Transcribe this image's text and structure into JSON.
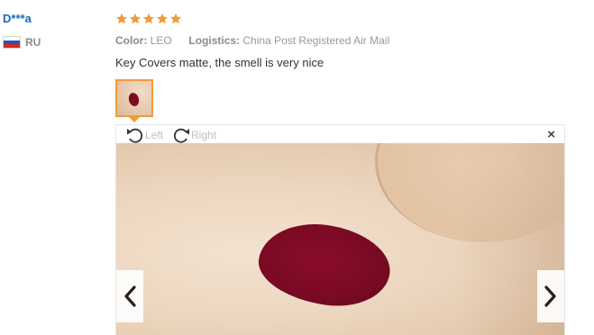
{
  "reviewer": {
    "name": "D***a",
    "country_code": "RU"
  },
  "rating": {
    "stars": 5,
    "max": 5,
    "color": "#f29a3a"
  },
  "attributes": {
    "color_key": "Color:",
    "color_value": "LEO",
    "logistics_key": "Logistics:",
    "logistics_value": "China Post Registered Air Mail"
  },
  "review_text": "Key Covers matte, the smell is very nice",
  "viewer": {
    "rotate_left_label": "Left",
    "rotate_right_label": "Right",
    "close_symbol": "×"
  },
  "icons": {
    "rotate_left": "rotate-left-icon",
    "rotate_right": "rotate-right-icon",
    "prev": "chevron-left-icon",
    "next": "chevron-right-icon"
  },
  "colors": {
    "reviewer_name": "#1a6bb8",
    "thumbnail_border": "#f29a3a",
    "lipstick": "#7a0a24"
  }
}
